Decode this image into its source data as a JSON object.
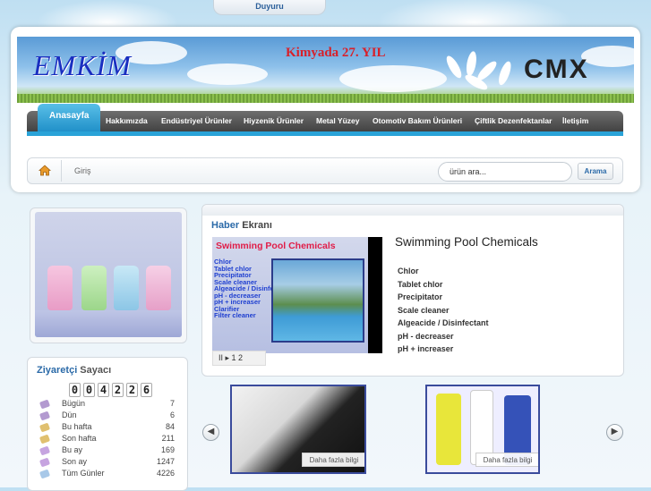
{
  "top_tab": {
    "label": "Duyuru"
  },
  "header": {
    "logo": "EMKİM",
    "slogan": "Kimyada 27. YIL",
    "brand": "CMX"
  },
  "nav": {
    "items": [
      {
        "label": "Anasayfa",
        "active": true
      },
      {
        "label": "Hakkımızda"
      },
      {
        "label": "Endüstriyel Ürünler"
      },
      {
        "label": "Hiyzenik Ürünler"
      },
      {
        "label": "Metal Yüzey"
      },
      {
        "label": "Otomotiv Bakım Ürünleri"
      },
      {
        "label": "Çiftlik Dezenfektanlar"
      },
      {
        "label": "İletişim"
      }
    ],
    "accent": "#2aa3d8"
  },
  "breadcrumb": {
    "home_icon": "home-icon",
    "current": "Giriş"
  },
  "search": {
    "value": "ürün ara...",
    "button": "Arama"
  },
  "counter": {
    "title_bold": "Ziyaretçi",
    "title_rest": " Sayacı",
    "digits": [
      "0",
      "0",
      "4",
      "2",
      "2",
      "6"
    ],
    "rows": [
      {
        "label": "Bügün",
        "value": "7"
      },
      {
        "label": "Dün",
        "value": "6"
      },
      {
        "label": "Bu hafta",
        "value": "84"
      },
      {
        "label": "Son hafta",
        "value": "211"
      },
      {
        "label": "Bu ay",
        "value": "169"
      },
      {
        "label": "Son ay",
        "value": "1247"
      },
      {
        "label": "Tüm Günler",
        "value": "4226"
      }
    ]
  },
  "news": {
    "header_bold": "Haber",
    "header_rest": " Ekranı",
    "slide_title": "Swimming Pool Chemicals",
    "slide_list": [
      "Chlor",
      "Tablet chlor",
      "Precipitator",
      "Scale cleaner",
      "Algeacide / Disinfectant",
      "pH - decreaser",
      "pH + increaser",
      "Clarifier",
      "Filter cleaner"
    ],
    "pager": "II ▸ 1 2",
    "title": "Swimming Pool Chemicals",
    "items": [
      "Chlor",
      "Tablet chlor",
      "Precipitator",
      "Scale cleaner",
      "Algeacide / Disinfectant",
      "pH - decreaser",
      "pH + increaser"
    ]
  },
  "carousel": {
    "prev_icon": "chevron-left-icon",
    "next_icon": "chevron-right-icon",
    "items": [
      {
        "more": "Daha fazla bilgi"
      },
      {
        "more": "Daha fazla bilgi"
      }
    ]
  }
}
